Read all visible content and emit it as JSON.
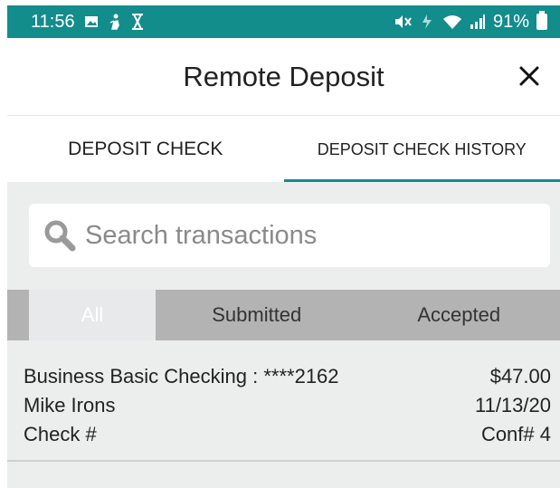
{
  "status_bar": {
    "time": "11:56",
    "battery": "91%",
    "left_icons": [
      "image-icon",
      "person-icon",
      "hourglass-icon"
    ],
    "right_icons": [
      "mute-icon",
      "charging-icon",
      "wifi-icon",
      "signal-icon",
      "battery-icon"
    ]
  },
  "header": {
    "title": "Remote Deposit",
    "close_icon": "close-icon"
  },
  "tabs": [
    {
      "label": "DEPOSIT CHECK",
      "active": false
    },
    {
      "label": "DEPOSIT CHECK HISTORY",
      "active": true
    }
  ],
  "search": {
    "placeholder": "Search transactions",
    "value": ""
  },
  "filters": [
    {
      "label": "All",
      "selected": true
    },
    {
      "label": "Submitted",
      "selected": false
    },
    {
      "label": "Accepted",
      "selected": false
    }
  ],
  "transactions": [
    {
      "account": "Business Basic Checking : ****2162",
      "amount": "$47.00",
      "name": "Mike Irons",
      "date": "11/13/20",
      "check": "Check #",
      "confirmation": "Conf# 4"
    }
  ],
  "colors": {
    "accent": "#138c8c",
    "panel_bg": "#eceded",
    "filter_bg": "#b3b3b3"
  }
}
